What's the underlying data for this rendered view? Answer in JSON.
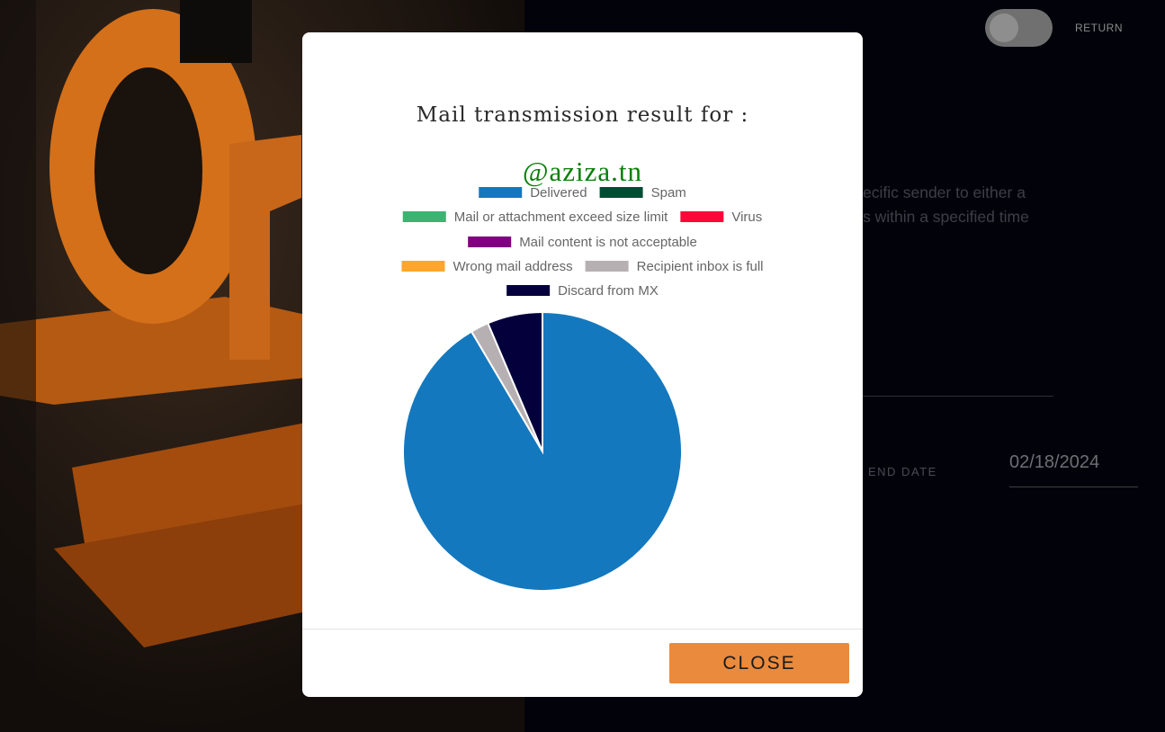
{
  "background": {
    "toggle_label": "RETURN",
    "description_visible": "ecific sender to either a\ns within a specified time",
    "end_date_label": "END DATE",
    "end_date_value": "02/18/2024"
  },
  "modal": {
    "title": "Mail transmission result for :",
    "domain": "@aziza.tn",
    "close_label": "CLOSE",
    "colors": {
      "accent": "#ea8a3d",
      "domain_text": "#0a7d0a"
    }
  },
  "chart_data": {
    "type": "pie",
    "legend_position": "top",
    "series": [
      {
        "name": "Delivered",
        "value": 91.5,
        "color": "#1478be"
      },
      {
        "name": "Spam",
        "value": 0,
        "color": "#004d33"
      },
      {
        "name": "Mail or attachment exceed size limit",
        "value": 0,
        "color": "#3cb371"
      },
      {
        "name": "Virus",
        "value": 0,
        "color": "#ff073a"
      },
      {
        "name": "Mail content is not acceptable",
        "value": 0,
        "color": "#800080"
      },
      {
        "name": "Wrong mail address",
        "value": 0,
        "color": "#ffa62b"
      },
      {
        "name": "Recipient inbox is full",
        "value": 2.1,
        "color": "#b7b0b3"
      },
      {
        "name": "Discard from MX",
        "value": 6.4,
        "color": "#04003c"
      }
    ]
  }
}
